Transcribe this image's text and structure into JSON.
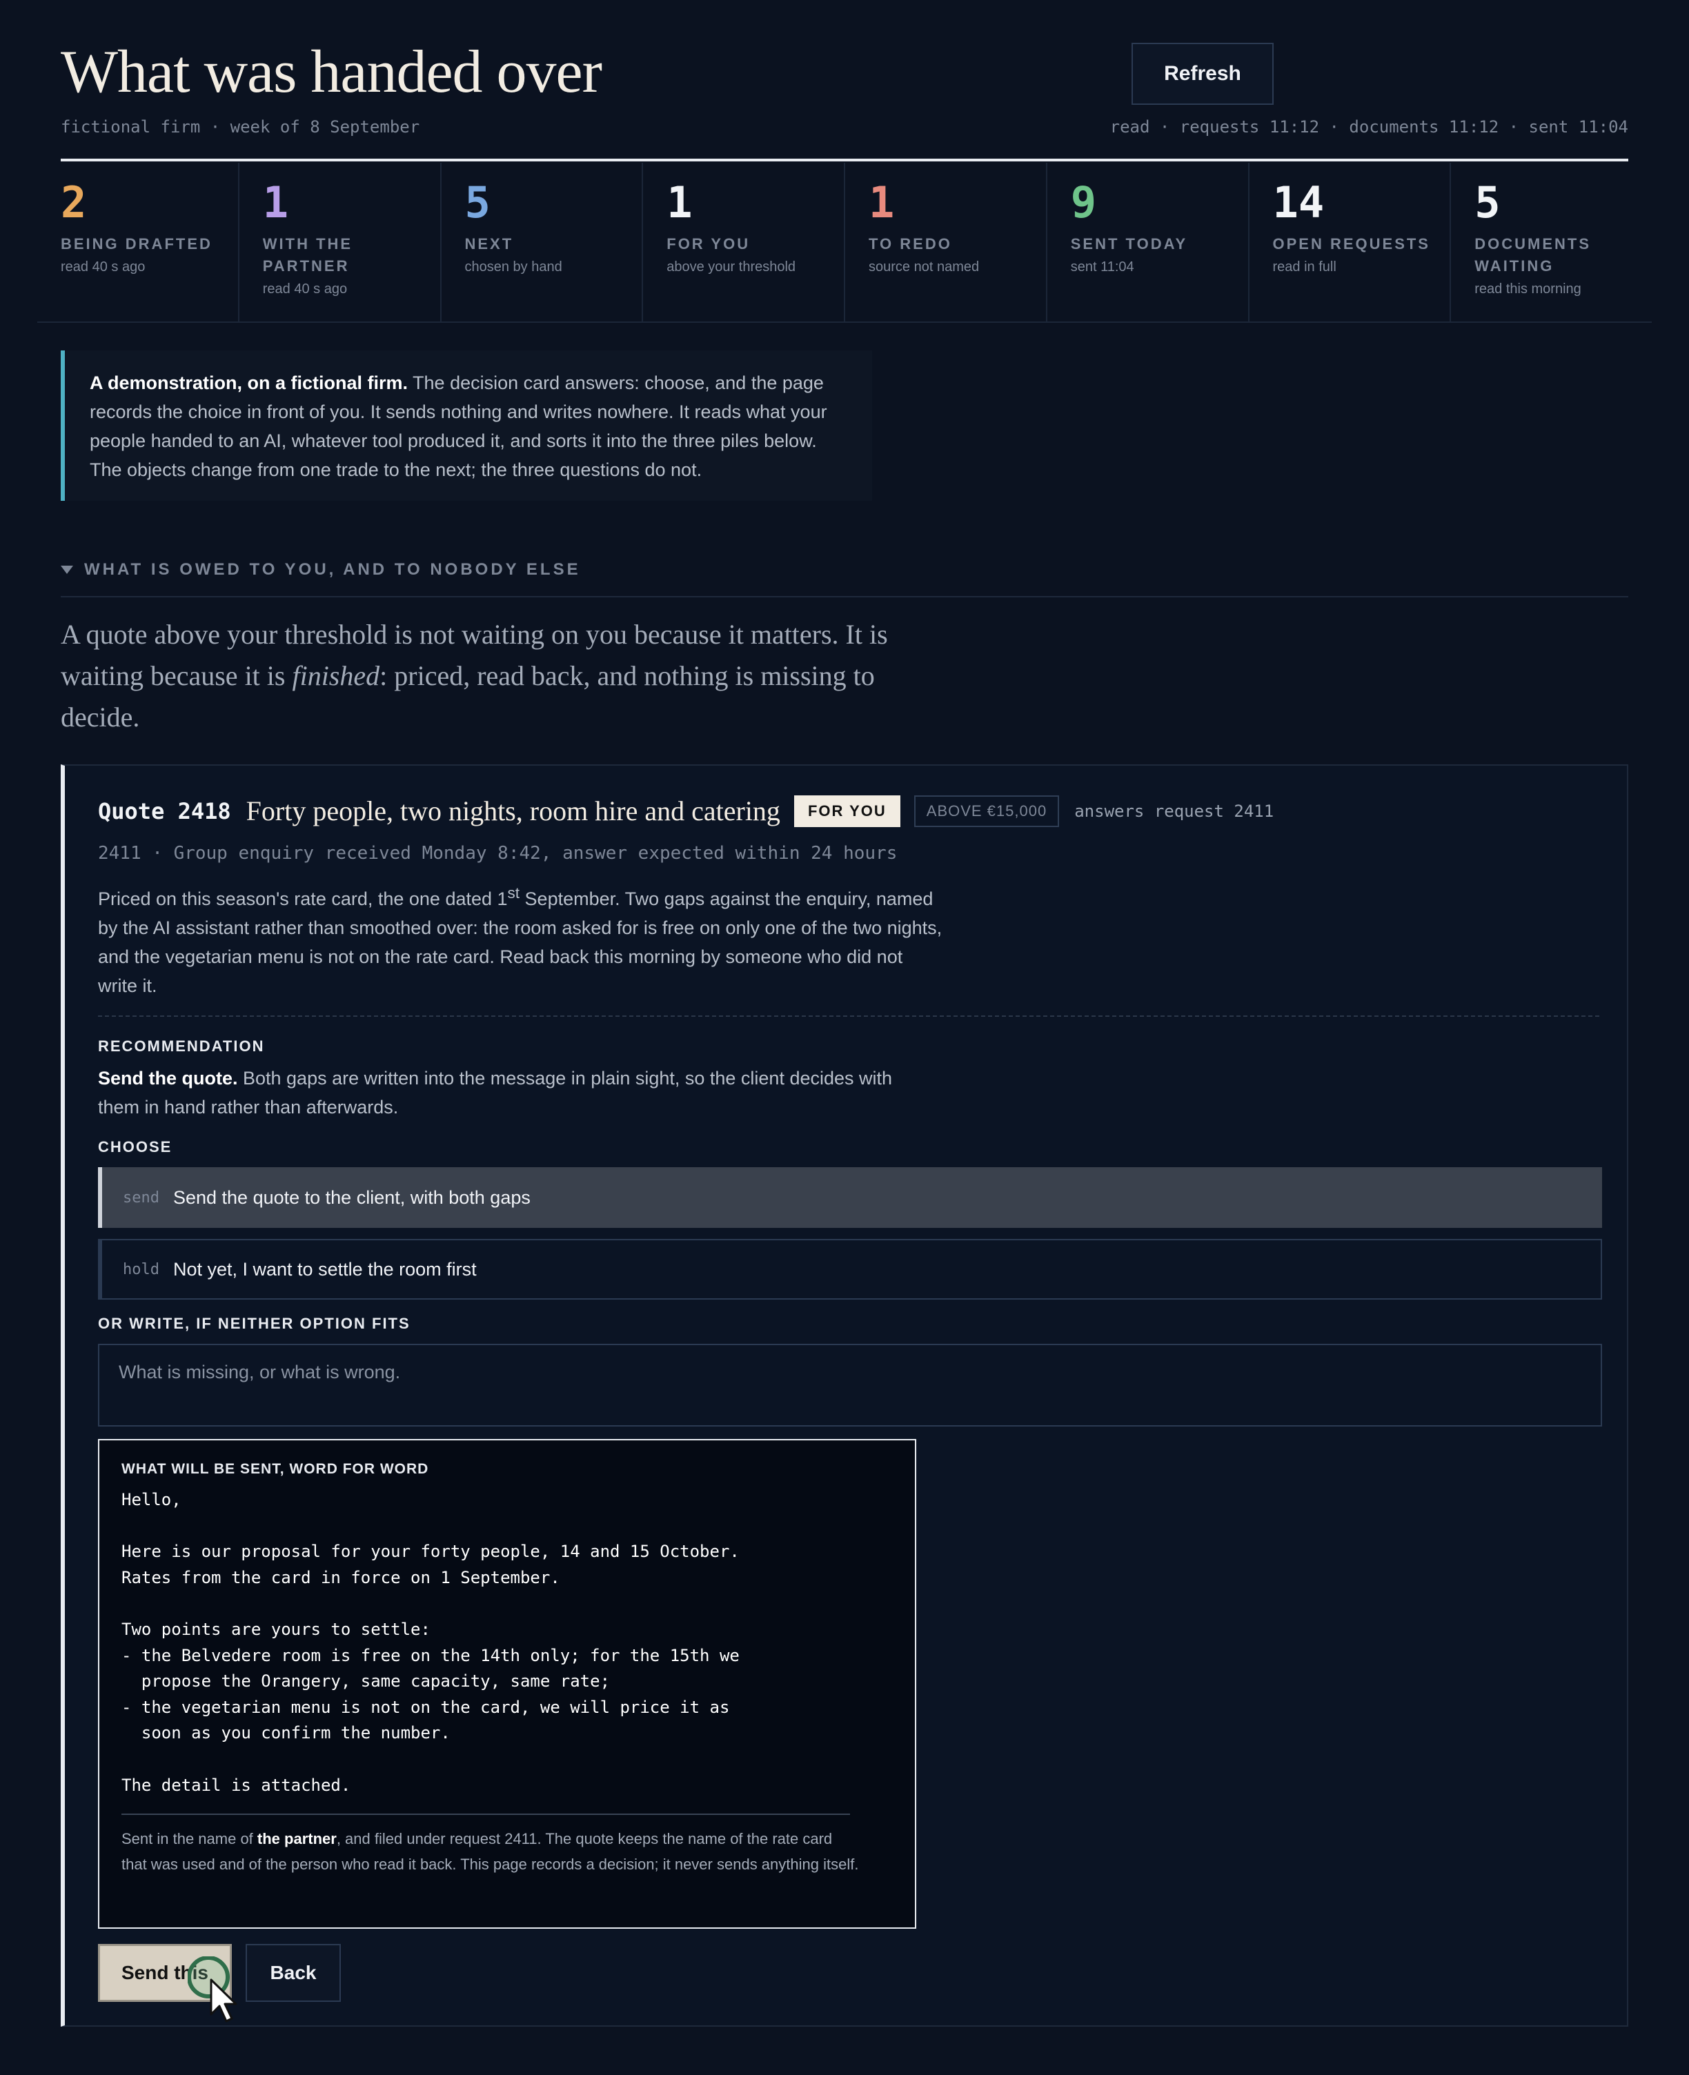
{
  "header": {
    "title": "What was handed over",
    "subtitle": "fictional firm · week of 8 September",
    "refresh_label": "Refresh",
    "read_status": "read · requests 11:12 · documents 11:12 · sent 11:04"
  },
  "stats": [
    {
      "number": "2",
      "label": "BEING DRAFTED",
      "sub": "read 40 s ago",
      "color": "#e8a85c"
    },
    {
      "number": "1",
      "label": "WITH THE PARTNER",
      "sub": "read 40 s ago",
      "color": "#b89ee8"
    },
    {
      "number": "5",
      "label": "NEXT",
      "sub": "chosen by hand",
      "color": "#7aa8e0"
    },
    {
      "number": "1",
      "label": "FOR YOU",
      "sub": "above your threshold",
      "color": "#f2f4f7"
    },
    {
      "number": "1",
      "label": "TO REDO",
      "sub": "source not named",
      "color": "#e88a7e"
    },
    {
      "number": "9",
      "label": "SENT TODAY",
      "sub": "sent 11:04",
      "color": "#6fc48a"
    },
    {
      "number": "14",
      "label": "OPEN REQUESTS",
      "sub": "read in full",
      "color": "#f2f4f7"
    },
    {
      "number": "5",
      "label": "DOCUMENTS WAITING",
      "sub": "read this morning",
      "color": "#f2f4f7"
    }
  ],
  "note": {
    "bold": "A demonstration, on a fictional firm.",
    "text": " The decision card answers: choose, and the page records the choice in front of you. It sends nothing and writes nowhere. It reads what your people handed to an AI, whatever tool produced it, and sorts it into the three piles below. The objects change from one trade to the next; the three questions do not."
  },
  "section": {
    "heading": "WHAT IS OWED TO YOU, AND TO NOBODY ELSE",
    "lead_1": "A quote above your threshold is not waiting on you because it matters. It is waiting because it is ",
    "lead_em": "finished",
    "lead_2": ": priced, read back, and nothing is missing to decide."
  },
  "card": {
    "id": "Quote 2418",
    "name": "Forty people, two nights, room hire and catering",
    "badge_for": "FOR YOU",
    "badge_above": "ABOVE €15,000",
    "answers": "answers request 2411",
    "meta": "2411 · Group enquiry received Monday 8:42, answer expected within 24 hours",
    "body_1": "Priced on this season's rate card, the one dated 1",
    "body_sup": "st",
    "body_2": " September. Two gaps against the enquiry, named by the AI assistant rather than smoothed over: the room asked for is free on only one of the two nights, and the vegetarian menu is not on the rate card. Read back this morning by someone who did not write it.",
    "rec_label": "RECOMMENDATION",
    "rec_bold": "Send the quote.",
    "rec_text": " Both gaps are written into the message in plain sight, so the client decides with them in hand rather than afterwards.",
    "choose_label": "CHOOSE",
    "options": [
      {
        "key": "send",
        "label": "Send the quote to the client, with both gaps"
      },
      {
        "key": "hold",
        "label": "Not yet, I want to settle the room first"
      }
    ],
    "write_label": "OR WRITE, IF NEITHER OPTION FITS",
    "write_placeholder": "What is missing, or what is wrong.",
    "preview_head": "WHAT WILL BE SENT, WORD FOR WORD",
    "preview_body": "Hello,\n\nHere is our proposal for your forty people, 14 and 15 October.\nRates from the card in force on 1 September.\n\nTwo points are yours to settle:\n- the Belvedere room is free on the 14th only; for the 15th we\n  propose the Orangery, same capacity, same rate;\n- the vegetarian menu is not on the card, we will price it as\n  soon as you confirm the number.\n\nThe detail is attached.",
    "foot_1": "Sent in the name of ",
    "foot_bold": "the partner",
    "foot_2": ", and filed under request 2411. The quote keeps the name of the rate card that was used and of the person who read it back. This page records a decision; it never sends anything itself.",
    "send_label": "Send this",
    "back_label": "Back"
  }
}
